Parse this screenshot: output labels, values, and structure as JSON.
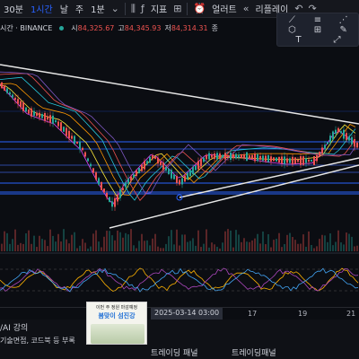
{
  "toolbar": {
    "interval_partial": "30분",
    "interval_active": "1시간",
    "interval_day": "날",
    "interval_week": "주",
    "interval_minute": "1분",
    "indicators": "지표",
    "alerts": "얼러트",
    "replay": "리플레이"
  },
  "symbol": {
    "name": "시간 · BINANCE",
    "o_label": "시",
    "o_value": "84,325.67",
    "h_label": "고",
    "h_value": "84,345.93",
    "l_label": "저",
    "l_value": "84,314.31",
    "c_label": "종"
  },
  "drawbar": {
    "tools": [
      "⟋",
      "≡",
      "⋰",
      "⬡",
      "⊞",
      "✎",
      "T",
      "⤢"
    ]
  },
  "time_axis": {
    "cursor": "2025-03-14  03:00",
    "ticks": [
      "17",
      "19",
      "21"
    ]
  },
  "bottom": {
    "line1": "/AI 강의",
    "line2": "기술면접, 코드북 등 부록",
    "tab1": "트레이딩 패널",
    "tab2": "트레이딩패널"
  },
  "ad": {
    "line1": "이번 주 정원 마감예정",
    "line2": "봄맞이 섬진강"
  },
  "colors": {
    "background": "#0b0d12",
    "accent": "#2962ff",
    "up": "#26a69a",
    "down": "#ef5350"
  }
}
